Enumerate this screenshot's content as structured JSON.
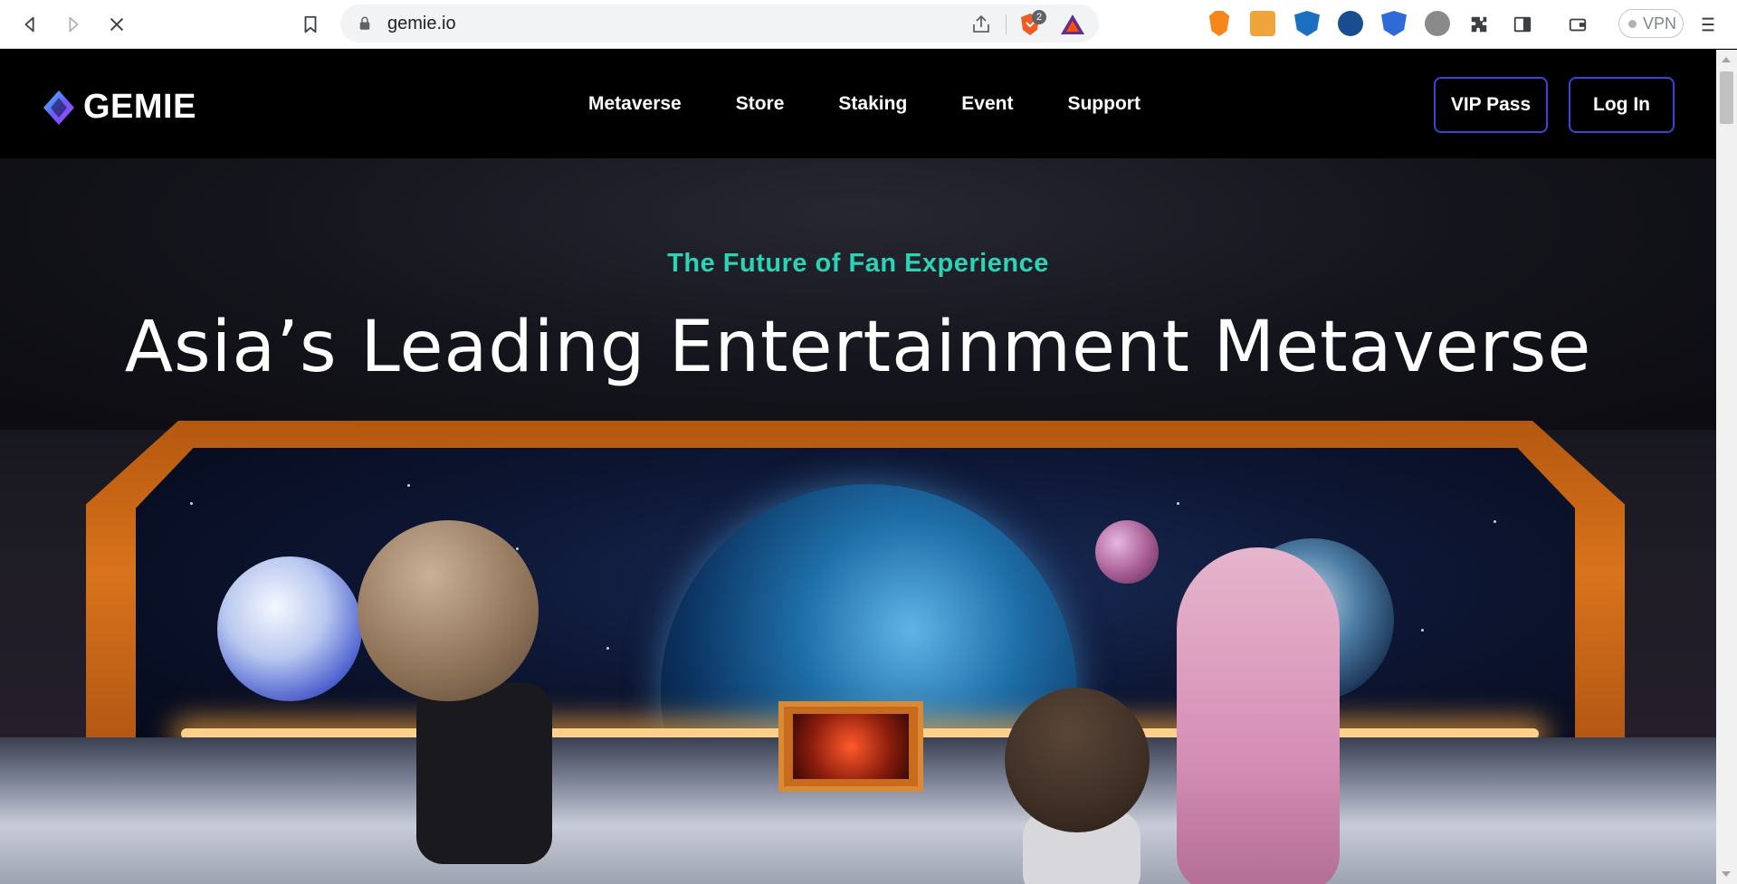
{
  "browser": {
    "url": "gemie.io",
    "brave_shield_count": "2",
    "vpn_label": "VPN",
    "icons": [
      "back-icon",
      "forward-icon",
      "stop-loading-icon",
      "bookmark-icon",
      "lock-icon",
      "share-icon",
      "brave-shield-icon",
      "bat-rewards-icon",
      "metamask-icon",
      "extension-icon",
      "wallet-icon",
      "menu-icon"
    ]
  },
  "site": {
    "logo_text": "GEMIE",
    "nav": [
      {
        "label": "Metaverse"
      },
      {
        "label": "Store"
      },
      {
        "label": "Staking"
      },
      {
        "label": "Event"
      },
      {
        "label": "Support"
      }
    ],
    "vip_button": "VIP Pass",
    "login_button": "Log In",
    "accent_color": "#3b43d9",
    "tagline_color": "#2bd4b4"
  },
  "hero": {
    "tagline": "The Future of Fan Experience",
    "headline": "Asia’s Leading Entertainment Metaverse"
  }
}
